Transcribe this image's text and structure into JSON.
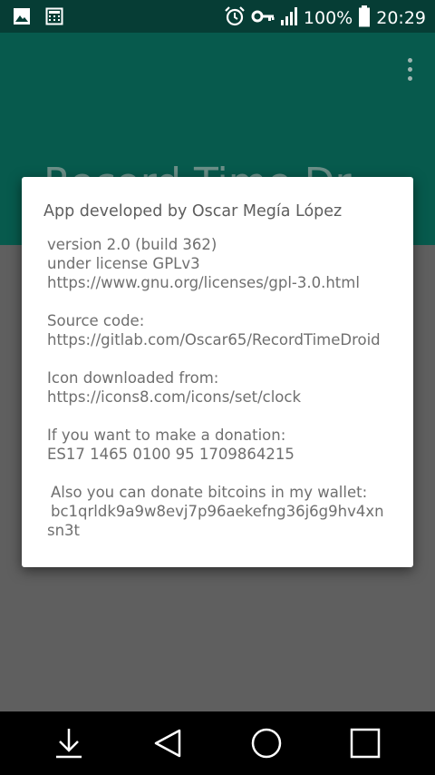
{
  "status_bar": {
    "battery_percent": "100%",
    "time": "20:29",
    "icons": [
      "image-icon",
      "calculator-icon",
      "alarm-icon",
      "vpn-key-icon",
      "signal-icon",
      "battery-icon"
    ]
  },
  "app_bar": {
    "title": "Record Time Dr",
    "overflow_menu_icon": "more-vertical-icon",
    "color": "#075a4d"
  },
  "dialog": {
    "title": "App developed by Oscar Megía López",
    "version": "version 2.0 (build 362)",
    "license": "under license GPLv3",
    "license_url": "https://www.gnu.org/licenses/gpl-3.0.html",
    "source_label": "Source code:",
    "source_url": "https://gitlab.com/Oscar65/RecordTimeDroid",
    "icon_label": "Icon downloaded from:",
    "icon_url": "https://icons8.com/icons/set/clock",
    "donation_label": "If you want to make a donation:",
    "donation_account": "ES17 1465 0100 95 1709864215",
    "bitcoin_label": "Also you can donate bitcoins in my wallet:",
    "bitcoin_wallet": "bc1qrldk9a9w8evj7p96aekefng36j6g9hv4xnsn3t"
  },
  "nav_bar": {
    "icons": [
      "hide-keyboard-icon",
      "back-icon",
      "home-icon",
      "recents-icon"
    ]
  }
}
